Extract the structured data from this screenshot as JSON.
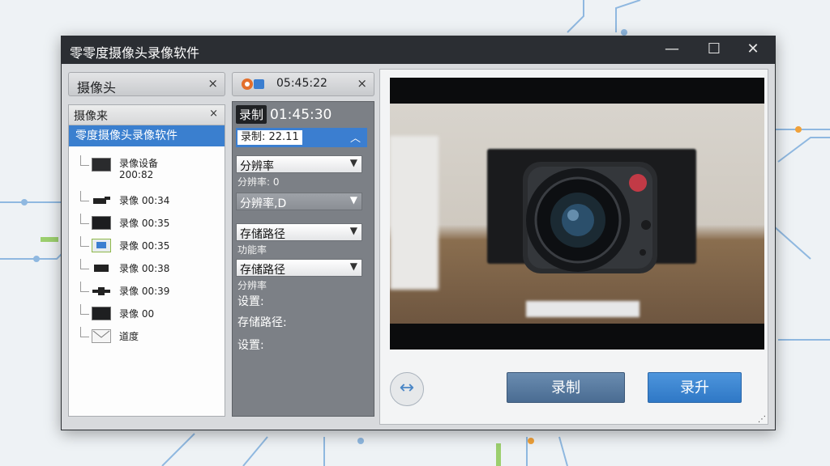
{
  "window": {
    "title": "零零度摄像头录像软件",
    "controls": {
      "minimize": "—",
      "maximize": "☐",
      "close": "✕"
    }
  },
  "left_panel": {
    "tab_label": "摄像头",
    "tab_close": "×",
    "tree_header": "摄像来",
    "tree_header_close": "×",
    "selected_item": "零度摄像头录像软件",
    "items": [
      {
        "label": "录像设备 200:82",
        "line1": "录像设备",
        "line2": "200:82"
      },
      {
        "label": "录像 00:34"
      },
      {
        "label": "录像 00:35"
      },
      {
        "label": "录像 00:35"
      },
      {
        "label": "录像 00:38"
      },
      {
        "label": "录像 00:39"
      },
      {
        "label": "录像 00"
      },
      {
        "label": "道度"
      }
    ]
  },
  "middle_panel": {
    "top_time": "05:45:22",
    "top_close": "×",
    "record_badge": "录制",
    "record_time": "01:45:30",
    "record_selected": "录制: 22.11",
    "resolution_dropdown": "分辨率",
    "resolution_sub": "分辨率: 0",
    "resolution_dropdown2": "分辨率,D",
    "storage_dropdown": "存储路径",
    "storage_sub": "功能率",
    "storage_dropdown2": "存储路径",
    "storage_sub2": "分辨率",
    "settings_label": "设置:",
    "storage_path_label": "存储路径:",
    "settings_label2": "设置:"
  },
  "right_panel": {
    "nav_icon": "↔",
    "record_button": "录制",
    "upload_button": "录升"
  },
  "colors": {
    "accent": "#3a7fcf",
    "titlebar": "#2b2e33",
    "middle_panel": "#7c8086"
  }
}
